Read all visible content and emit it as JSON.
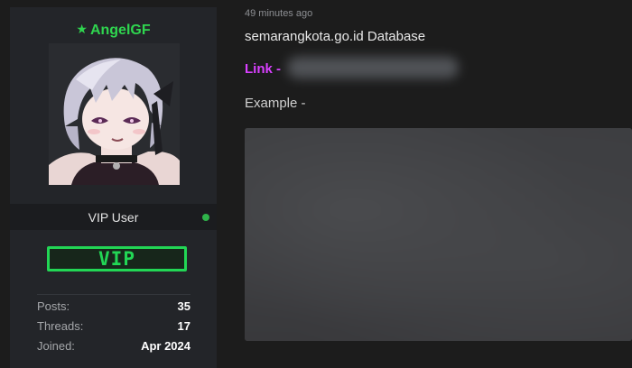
{
  "user": {
    "star_icon": "★",
    "username": "AngelGF",
    "role": "VIP User",
    "badge": "VIP",
    "online_status_color": "#2fb34a",
    "name_color": "#2fd54f"
  },
  "stats": [
    {
      "label": "Posts:",
      "value": "35"
    },
    {
      "label": "Threads:",
      "value": "17"
    },
    {
      "label": "Joined:",
      "value": "Apr 2024"
    }
  ],
  "post": {
    "timestamp": "49 minutes ago",
    "title": "semarangkota.go.id Database",
    "link_label": "Link -",
    "example_label": "Example -"
  },
  "colors": {
    "accent_link": "#d940ff",
    "vip_green": "#22d655",
    "background": "#1c1c1c",
    "sidebar": "#232529"
  }
}
